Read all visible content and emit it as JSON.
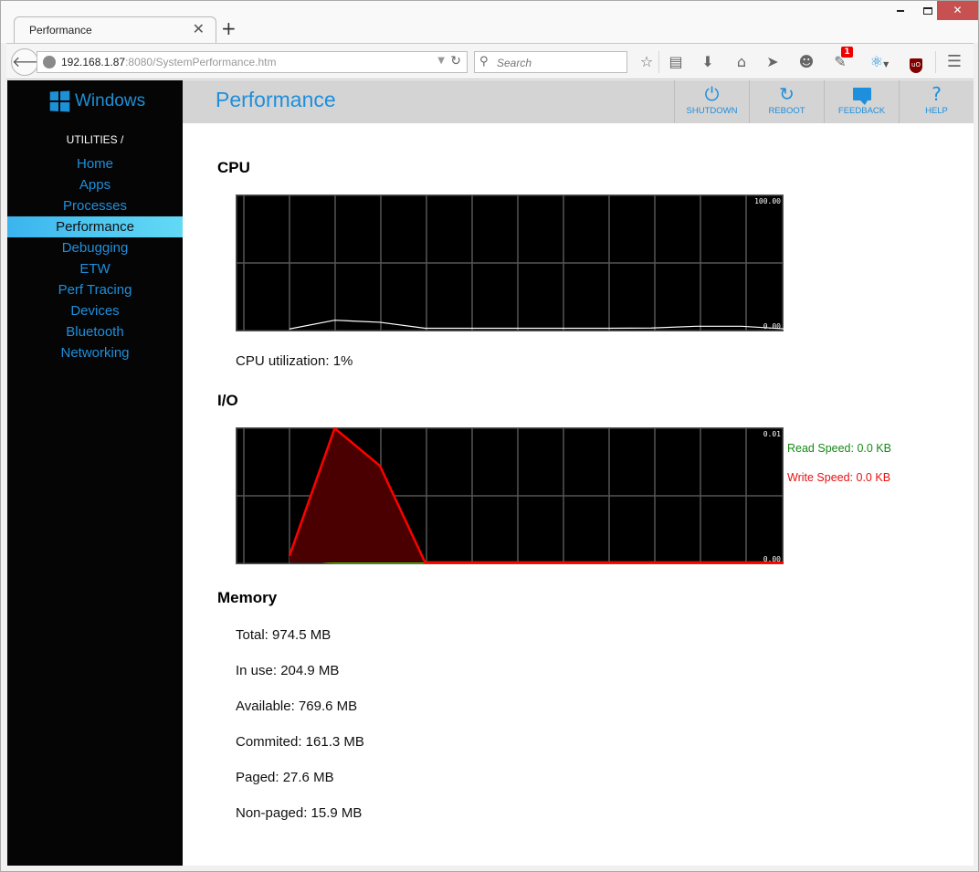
{
  "browser": {
    "tab_title": "Performance",
    "url_host": "192.168.1.87",
    "url_rest": ":8080/SystemPerformance.htm",
    "search_placeholder": "Search",
    "notification_badge": "1",
    "toolbar_icons": [
      "bookmark-star-icon",
      "reading-list-icon",
      "download-icon",
      "home-icon",
      "send-icon",
      "emoji-icon",
      "extension-notification-icon",
      "network-extension-icon",
      "ublock-icon",
      "menu-icon"
    ]
  },
  "sidebar": {
    "logo_text": "Windows",
    "section_label": "UTILITIES /",
    "items": [
      {
        "label": "Home",
        "active": false
      },
      {
        "label": "Apps",
        "active": false
      },
      {
        "label": "Processes",
        "active": false
      },
      {
        "label": "Performance",
        "active": true
      },
      {
        "label": "Debugging",
        "active": false
      },
      {
        "label": "ETW",
        "active": false
      },
      {
        "label": "Perf Tracing",
        "active": false
      },
      {
        "label": "Devices",
        "active": false
      },
      {
        "label": "Bluetooth",
        "active": false
      },
      {
        "label": "Networking",
        "active": false
      }
    ]
  },
  "header": {
    "title": "Performance",
    "buttons": [
      {
        "label": "SHUTDOWN",
        "icon": "power-icon"
      },
      {
        "label": "REBOOT",
        "icon": "refresh-icon"
      },
      {
        "label": "FEEDBACK",
        "icon": "speech-bubble-icon"
      },
      {
        "label": "HELP",
        "icon": "question-mark-icon"
      }
    ]
  },
  "cpu": {
    "heading": "CPU",
    "utilization_text": "CPU utilization: 1%"
  },
  "io": {
    "heading": "I/O",
    "read_speed_text": "Read Speed: 0.0 KB",
    "write_speed_text": "Write Speed: 0.0 KB"
  },
  "memory": {
    "heading": "Memory",
    "stats": [
      "Total: 974.5 MB",
      "In use: 204.9 MB",
      "Available: 769.6 MB",
      "Commited: 161.3 MB",
      "Paged: 27.6 MB",
      "Non-paged: 15.9 MB"
    ]
  },
  "colors": {
    "accent": "#1e8fdc",
    "read": "#44bb00",
    "write": "#ff0000",
    "write_fill": "#4a0000",
    "cpu_line": "#ffffff",
    "grid": "#555555"
  },
  "chart_data": [
    {
      "type": "line",
      "title": "CPU",
      "ylim": [
        0,
        100
      ],
      "tick_labels": [
        "100.00",
        "0.00"
      ],
      "grid": true,
      "series": [
        {
          "name": "CPU",
          "values": [
            0.5,
            7,
            5.5,
            1,
            1,
            1,
            1,
            1,
            1.2,
            2.5,
            2.5,
            0.5
          ]
        }
      ]
    },
    {
      "type": "area",
      "title": "I/O",
      "ylim": [
        0,
        0.01
      ],
      "tick_labels": [
        "0.01",
        "0.00"
      ],
      "grid": true,
      "legend": "right",
      "series": [
        {
          "name": "Read Speed",
          "values": [
            0.0003,
            0,
            0,
            0,
            0,
            0,
            0,
            0,
            0,
            0,
            0,
            0
          ]
        },
        {
          "name": "Write Speed",
          "values": [
            0.0005,
            0.01,
            0.0072,
            0,
            0,
            0,
            0,
            0,
            0,
            0,
            0,
            0
          ]
        }
      ]
    }
  ]
}
